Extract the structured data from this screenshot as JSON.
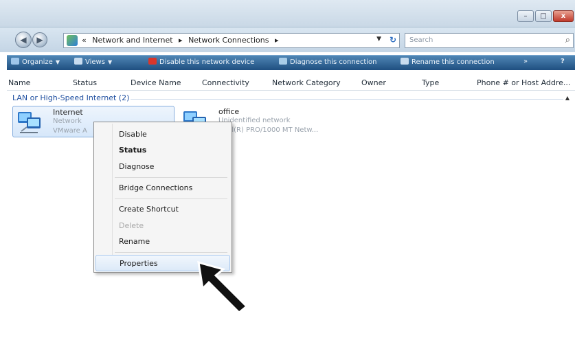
{
  "window": {
    "caption": {
      "minimize": "–",
      "maximize": "□",
      "close": "x"
    }
  },
  "address_bar": {
    "prefix": "«",
    "crumbs": [
      "Network and Internet",
      "▸",
      "Network Connections",
      "▸"
    ],
    "search_placeholder": "Search"
  },
  "toolbar": {
    "organize": "Organize",
    "views": "Views",
    "disable": "Disable this network device",
    "diagnose": "Diagnose this connection",
    "rename": "Rename this connection",
    "more": "»",
    "help": "?"
  },
  "columns": [
    "Name",
    "Status",
    "Device Name",
    "Connectivity",
    "Network Category",
    "Owner",
    "Type",
    "Phone # or Host Addre..."
  ],
  "group": {
    "header": "LAN or High-Speed Internet (2)"
  },
  "connections": [
    {
      "name": "Internet",
      "status": "Network",
      "device": "VMware A"
    },
    {
      "name": "office",
      "status": "Unidentified network",
      "device": "Intel(R) PRO/1000 MT Netw..."
    }
  ],
  "context_menu": {
    "items": [
      {
        "label": "Disable"
      },
      {
        "label": "Status"
      },
      {
        "label": "Diagnose"
      },
      {
        "label": "Bridge Connections"
      },
      {
        "label": "Create Shortcut"
      },
      {
        "label": "Delete"
      },
      {
        "label": "Rename"
      },
      {
        "label": "Properties"
      }
    ]
  },
  "colors": {
    "toolbar_top": "#4f86b5",
    "toolbar_bottom": "#1f4f80",
    "group_header": "#1f4fa0",
    "close_button": "#c0392b",
    "pointer": "#111111"
  },
  "icons": {
    "back": "arrow-left-icon",
    "forward": "arrow-right-icon",
    "network": "network-adapter-icon",
    "search": "magnifier-icon",
    "pointer": "arrow-pointer-icon"
  }
}
